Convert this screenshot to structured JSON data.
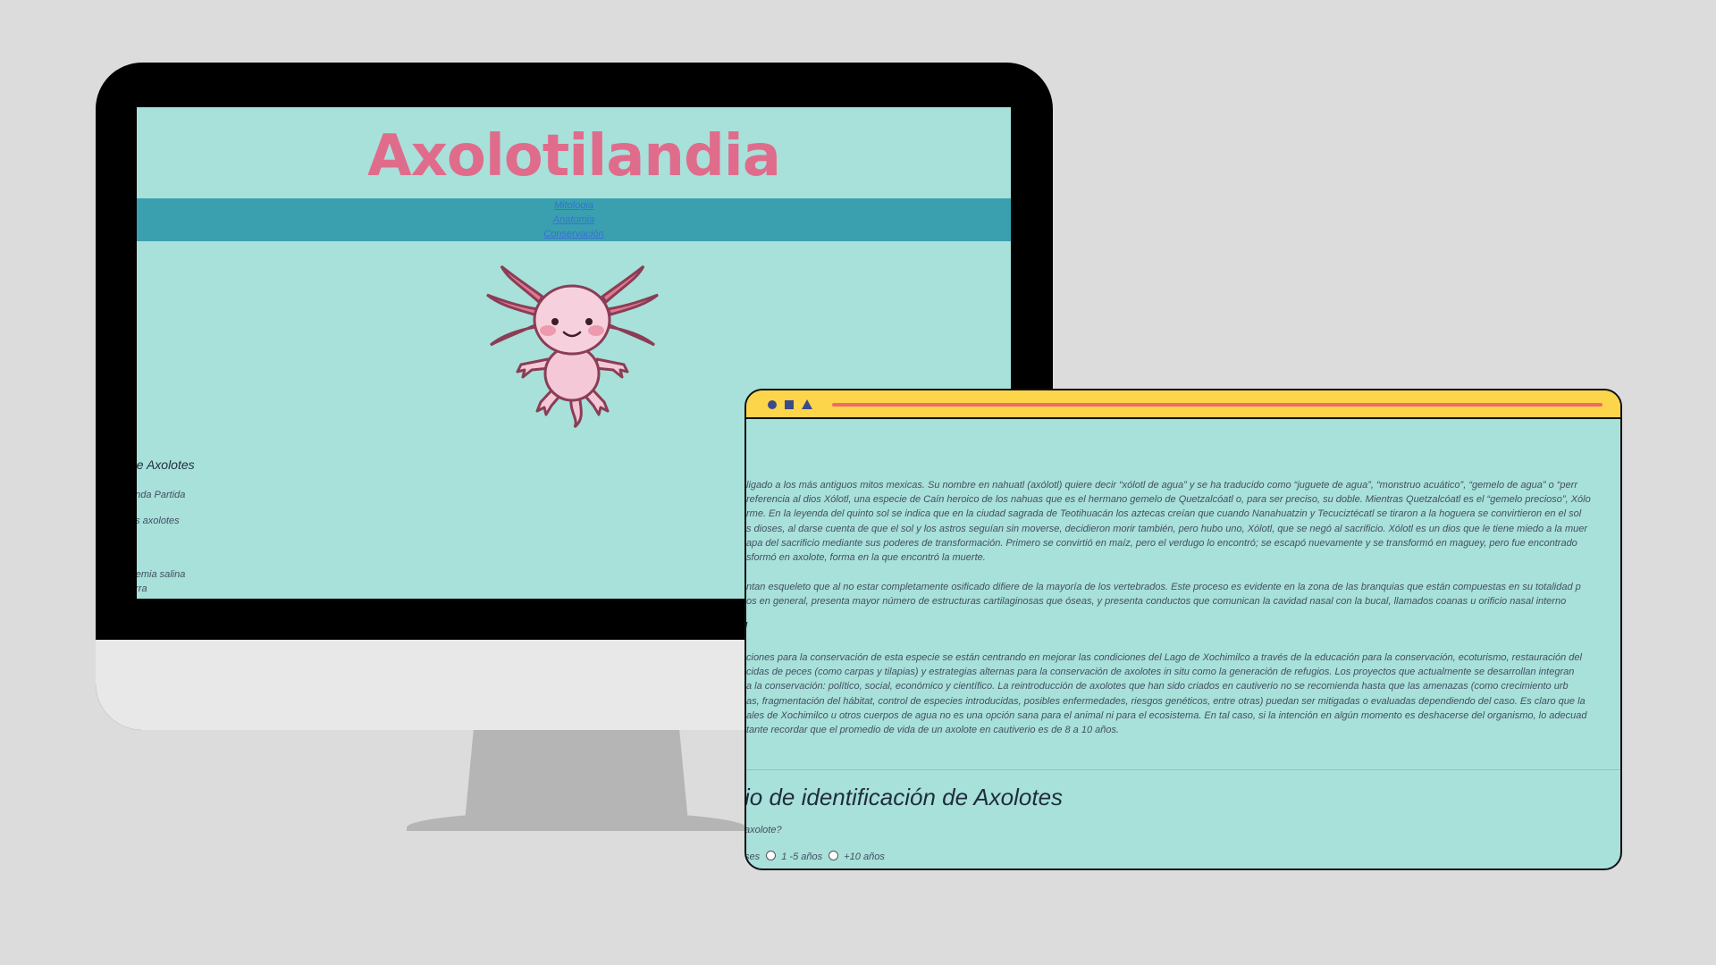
{
  "site": {
    "title": "Axolotilandia",
    "nav": [
      "Mitologia",
      "Anatomia",
      "Conservación"
    ]
  },
  "monitor_form": {
    "heading": "de Axolotes",
    "lines": [
      "anda Partida",
      "os axolotes",
      "ia",
      "rtemia salina",
      "erra"
    ]
  },
  "tablet": {
    "mitologia": [
      "ligado a los más antiguos mitos mexicas. Su nombre en nahuatl (axólotl) quiere decir “xólotl de agua” y se ha traducido como “juguete de agua”, “monstruo acuático”, “gemelo de agua” o “perr",
      "referencia al dios Xólotl, una especie de Caín heroico de los nahuas que es el hermano gemelo de Quetzalcóatl o, para ser preciso, su doble. Mientras Quetzalcóatl es el “gemelo precioso”, Xólo",
      "rme. En la leyenda del quinto sol se indica que en la ciudad sagrada de Teotihuacán los aztecas creían que cuando Nanahuatzin y Tecuciztécatl se tiraron a la hoguera se convirtieron en el sol",
      "s dioses, al darse cuenta de que el sol y los astros seguían sin moverse, decidieron morir también, pero hubo uno, Xólotl, que se negó al sacrificio. Xólotl es un dios que le tiene miedo a la muer",
      "apa del sacrificio mediante sus poderes de transformación. Primero se convirtió en maíz, pero el verdugo lo encontró; se escapó nuevamente y se transformó en maguey, pero fue encontrado",
      "sformó en axolote, forma en la que encontró la muerte."
    ],
    "anatomia": [
      "ntan esqueleto que al no estar completamente osificado difiere de la mayoría de los vertebrados. Este proceso es evidente en la zona de las branquias que están compuestas en su totalidad p",
      "os en general, presenta mayor número de estructuras cartilaginosas que óseas, y presenta conductos que comunican la cavidad nasal con la bucal, llamados coanas u orificio nasal interno"
    ],
    "conservacion_heading": "l",
    "conservacion": [
      "ciones para la conservación de esta especie se están centrando en mejorar las condiciones del Lago de Xochimilco a través de la educación para la conservación, ecoturismo, restauración del",
      "cidas de peces (como carpas y tilapias) y estrategias alternas para la conservación de axolotes in situ como la generación de refugios. Los proyectos que actualmente se desarrollan integran",
      "a la conservación: político, social, económico y científico. La reintroducción de axolotes que han sido criados en cautiverio no se recomienda hasta que las amenazas (como crecimiento urb",
      "as, fragmentación del hábitat, control de especies introducidas, posibles enfermedades, riesgos genéticos, entre otras) puedan ser mitigadas o evaluadas dependiendo del caso. Es claro que la",
      "ales de Xochimilco u otros cuerpos de agua no es una opción sana para el animal ni para el ecosistema. En tal caso, si la intención en algún momento es deshacerse del organismo, lo adecuad",
      "tante recordar que el promedio de vida de un axolote en cautiverio es de 8 a 10 años."
    ],
    "form_heading": "io de identificación de Axolotes",
    "question": "axolote?",
    "options": [
      "ses",
      "1 -5 años",
      "+10 años"
    ]
  },
  "colors": {
    "page_bg": "#dcdcdc",
    "site_bg": "#a8e0da",
    "nav_bg": "#3aa0b0",
    "title": "#e06c8c",
    "window_bar": "#fcd54a",
    "window_bar_line": "#ef6b6b"
  },
  "icons": [
    "axolotl-illustration",
    "window-circle-icon",
    "window-square-icon",
    "window-triangle-icon"
  ]
}
